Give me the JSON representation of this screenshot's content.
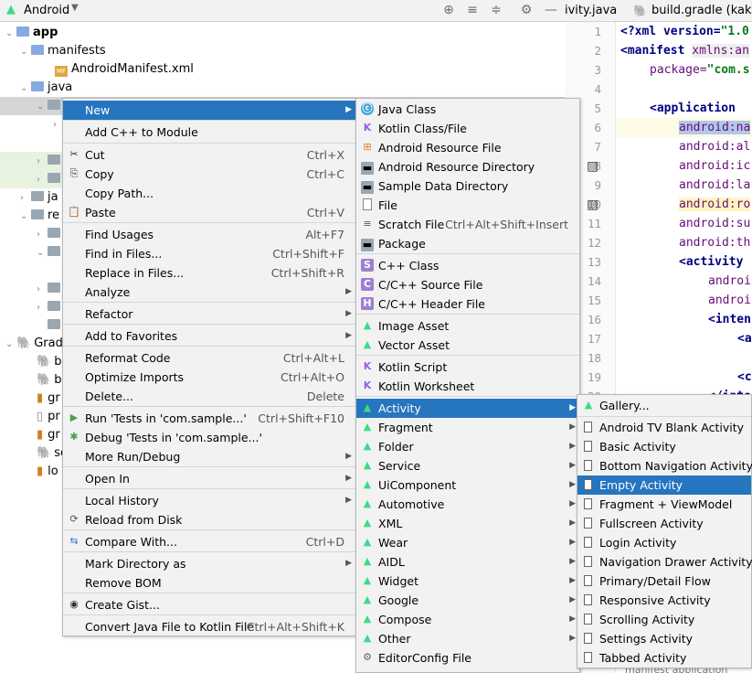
{
  "toolbar": {
    "title": "Android"
  },
  "tabs": [
    {
      "label": "ivity.java"
    },
    {
      "label": "build.gradle (kakaoLo"
    }
  ],
  "tree": {
    "app": "app",
    "manifests": "manifests",
    "androidmanifest": "AndroidManifest.xml",
    "java": "java",
    "ja": "ja",
    "re1": "re",
    "re2": "re",
    "gradle": "Gradl",
    "bu1": "bu",
    "bu2": "bu",
    "gr1": "gr",
    "pr": "pr",
    "gr2": "gr",
    "se": "se",
    "lo": "lo"
  },
  "line_numbers": [
    "1",
    "2",
    "3",
    "4",
    "5",
    "6",
    "7",
    "8",
    "9",
    "10",
    "11",
    "12",
    "13",
    "14",
    "15",
    "16",
    "17",
    "18",
    "19",
    "20"
  ],
  "code": {
    "l1a": "<?xml version=",
    "l1b": "\"1.0",
    "l2a": "<manifest ",
    "l2b": "xmlns:an",
    "l3a": "package=",
    "l3b": "\"com.s",
    "l5": "<application",
    "l6": "android:na",
    "l7": "android:al",
    "l8": "android:ic",
    "l9": "android:la",
    "l10": "android:ro",
    "l11": "android:su",
    "l12": "android:th",
    "l13": "<activity",
    "l14": "androi",
    "l15": "androi",
    "l16": "<inten",
    "l17": "<a",
    "l19": "<c",
    "l20": "</inte",
    "status": "manifest  application"
  },
  "context_menu": [
    {
      "label": "New",
      "shortcut": "",
      "icon": "",
      "selected": true
    },
    {
      "label": "Add C++ to Module",
      "shortcut": ""
    },
    {
      "label": "Cut",
      "shortcut": "Ctrl+X",
      "icon": "scissors-icon"
    },
    {
      "label": "Copy",
      "shortcut": "Ctrl+C",
      "icon": "copy-icon"
    },
    {
      "label": "Copy Path...",
      "shortcut": ""
    },
    {
      "label": "Paste",
      "shortcut": "Ctrl+V",
      "icon": "paste-icon"
    },
    {
      "label": "Find Usages",
      "shortcut": "Alt+F7"
    },
    {
      "label": "Find in Files...",
      "shortcut": "Ctrl+Shift+F"
    },
    {
      "label": "Replace in Files...",
      "shortcut": "Ctrl+Shift+R"
    },
    {
      "label": "Analyze",
      "shortcut": ""
    },
    {
      "label": "Refactor",
      "shortcut": ""
    },
    {
      "label": "Add to Favorites",
      "shortcut": ""
    },
    {
      "label": "Reformat Code",
      "shortcut": "Ctrl+Alt+L"
    },
    {
      "label": "Optimize Imports",
      "shortcut": "Ctrl+Alt+O"
    },
    {
      "label": "Delete...",
      "shortcut": "Delete"
    },
    {
      "label": "Run 'Tests in 'com.sample...'",
      "shortcut": "Ctrl+Shift+F10",
      "icon": "run-icon"
    },
    {
      "label": "Debug 'Tests in 'com.sample...'",
      "shortcut": "",
      "icon": "debug-icon"
    },
    {
      "label": "More Run/Debug",
      "shortcut": ""
    },
    {
      "label": "Open In",
      "shortcut": ""
    },
    {
      "label": "Local History",
      "shortcut": ""
    },
    {
      "label": "Reload from Disk",
      "shortcut": "",
      "icon": "reload-icon"
    },
    {
      "label": "Compare With...",
      "shortcut": "Ctrl+D",
      "icon": "compare-icon"
    },
    {
      "label": "Mark Directory as",
      "shortcut": ""
    },
    {
      "label": "Remove BOM",
      "shortcut": ""
    },
    {
      "label": "Create Gist...",
      "shortcut": "",
      "icon": "github-icon"
    },
    {
      "label": "Convert Java File to Kotlin File",
      "shortcut": "Ctrl+Alt+Shift+K"
    }
  ],
  "new_menu": [
    {
      "label": "Java Class",
      "shortcut": ""
    },
    {
      "label": "Kotlin Class/File",
      "shortcut": ""
    },
    {
      "label": "Android Resource File",
      "shortcut": ""
    },
    {
      "label": "Android Resource Directory",
      "shortcut": ""
    },
    {
      "label": "Sample Data Directory",
      "shortcut": ""
    },
    {
      "label": "File",
      "shortcut": ""
    },
    {
      "label": "Scratch File",
      "shortcut": "Ctrl+Alt+Shift+Insert"
    },
    {
      "label": "Package",
      "shortcut": ""
    },
    {
      "label": "C++ Class",
      "shortcut": ""
    },
    {
      "label": "C/C++ Source File",
      "shortcut": ""
    },
    {
      "label": "C/C++ Header File",
      "shortcut": ""
    },
    {
      "label": "Image Asset",
      "shortcut": ""
    },
    {
      "label": "Vector Asset",
      "shortcut": ""
    },
    {
      "label": "Kotlin Script",
      "shortcut": ""
    },
    {
      "label": "Kotlin Worksheet",
      "shortcut": ""
    },
    {
      "label": "Activity",
      "shortcut": "",
      "selected": true
    },
    {
      "label": "Fragment"
    },
    {
      "label": "Folder"
    },
    {
      "label": "Service"
    },
    {
      "label": "UiComponent"
    },
    {
      "label": "Automotive"
    },
    {
      "label": "XML"
    },
    {
      "label": "Wear"
    },
    {
      "label": "AIDL"
    },
    {
      "label": "Widget"
    },
    {
      "label": "Google"
    },
    {
      "label": "Compose"
    },
    {
      "label": "Other"
    },
    {
      "label": "EditorConfig File"
    }
  ],
  "activity_menu": [
    {
      "label": "Gallery..."
    },
    {
      "label": "Android TV Blank Activity"
    },
    {
      "label": "Basic Activity"
    },
    {
      "label": "Bottom Navigation Activity"
    },
    {
      "label": "Empty Activity",
      "selected": true
    },
    {
      "label": "Fragment + ViewModel"
    },
    {
      "label": "Fullscreen Activity"
    },
    {
      "label": "Login Activity"
    },
    {
      "label": "Navigation Drawer Activity"
    },
    {
      "label": "Primary/Detail Flow"
    },
    {
      "label": "Responsive Activity"
    },
    {
      "label": "Scrolling Activity"
    },
    {
      "label": "Settings Activity"
    },
    {
      "label": "Tabbed Activity"
    }
  ]
}
